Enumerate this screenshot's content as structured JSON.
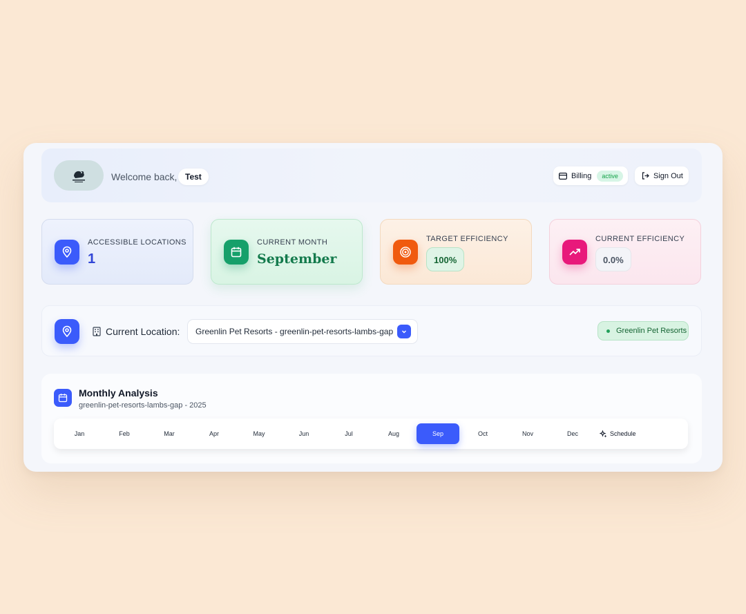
{
  "header": {
    "welcome_text": "Welcome back,",
    "user_name": "Test",
    "billing_label": "Billing",
    "billing_status": "active",
    "signout_label": "Sign Out"
  },
  "stats": [
    {
      "label": "ACCESSIBLE LOCATIONS",
      "value": "1",
      "icon": "map-pin-icon"
    },
    {
      "label": "CURRENT MONTH",
      "value": "September",
      "icon": "calendar-icon"
    },
    {
      "label": "TARGET EFFICIENCY",
      "value": "100%",
      "icon": "target-icon"
    },
    {
      "label": "CURRENT EFFICIENCY",
      "value": "0.0%",
      "icon": "trending-up-icon"
    }
  ],
  "location": {
    "label": "Current Location:",
    "selected": "Greenlin Pet Resorts - greenlin-pet-resorts-lambs-gap",
    "org_badge": "Greenlin Pet Resorts"
  },
  "analysis": {
    "title": "Monthly Analysis",
    "subtitle": "greenlin-pet-resorts-lambs-gap - 2025",
    "months": [
      "Jan",
      "Feb",
      "Mar",
      "Apr",
      "May",
      "Jun",
      "Jul",
      "Aug",
      "Sep",
      "Oct",
      "Nov",
      "Dec"
    ],
    "selected_month": "Sep",
    "schedule_label": "Schedule"
  },
  "colors": {
    "accent": "#3b5bfb",
    "green": "#16a06a",
    "orange": "#f05a0e",
    "pink": "#e8197b",
    "page_background": "#fbe8d4"
  }
}
